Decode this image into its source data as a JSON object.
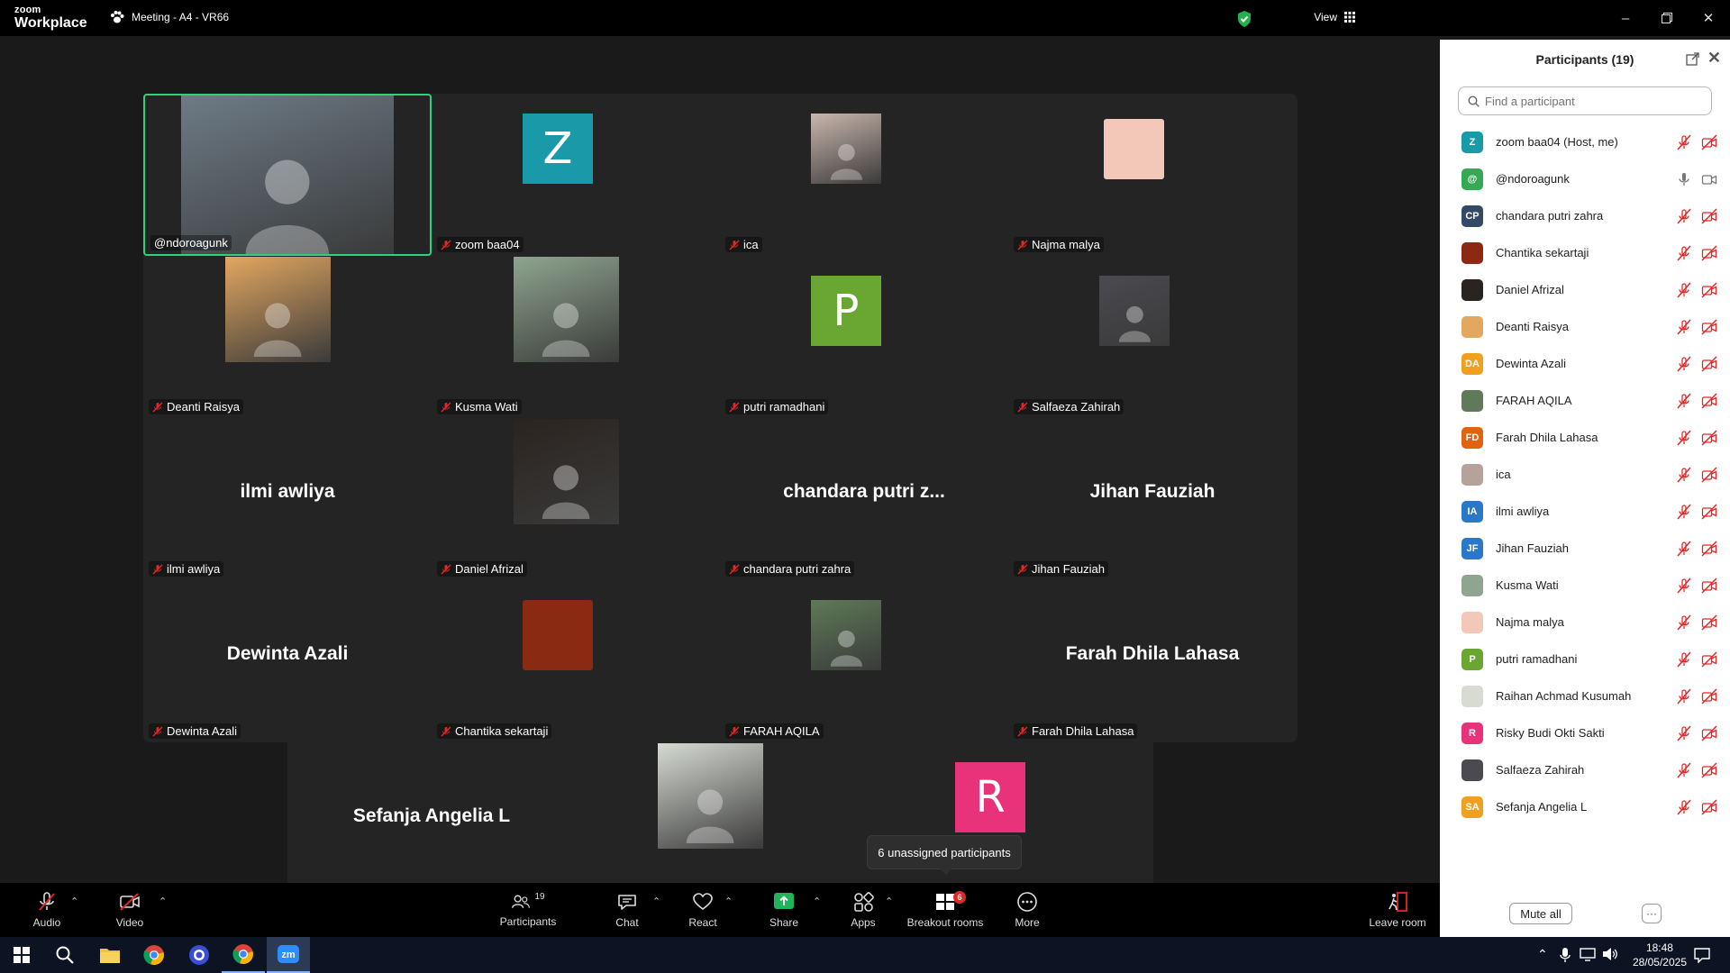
{
  "titlebar": {
    "brand_top": "zoom",
    "brand_bottom": "Workplace",
    "meeting_title": "Meeting - A4 - VR66",
    "view_label": "View"
  },
  "tiles": [
    {
      "label": "@ndoroagunk",
      "big": "",
      "kind": "photo",
      "color": "#6d7b86",
      "muted": false
    },
    {
      "label": "zoom baa04",
      "big": "",
      "kind": "letter",
      "letter": "Z",
      "color": "#1a9aa8",
      "muted": true
    },
    {
      "label": "ica",
      "big": "",
      "kind": "photo",
      "color": "#c9b7ad",
      "muted": true
    },
    {
      "label": "Najma malya",
      "big": "",
      "kind": "solid",
      "color": "#f3c8b9",
      "muted": true
    },
    {
      "label": "Deanti Raisya",
      "big": "",
      "kind": "photo",
      "color": "#e3a760",
      "muted": true
    },
    {
      "label": "Kusma Wati",
      "big": "",
      "kind": "photo",
      "color": "#8fa58f",
      "muted": true
    },
    {
      "label": "putri ramadhani",
      "big": "",
      "kind": "letter",
      "letter": "P",
      "color": "#6aa632",
      "muted": true
    },
    {
      "label": "Salfaeza Zahirah",
      "big": "",
      "kind": "photo",
      "color": "#4a4a50",
      "muted": true
    },
    {
      "label": "ilmi awliya",
      "big": "ilmi awliya",
      "kind": "text",
      "muted": true
    },
    {
      "label": "Daniel Afrizal",
      "big": "",
      "kind": "photo",
      "color": "#2a2420",
      "muted": true
    },
    {
      "label": "chandara putri zahra",
      "big": "chandara putri z...",
      "kind": "text",
      "muted": true
    },
    {
      "label": "Jihan Fauziah",
      "big": "Jihan Fauziah",
      "kind": "text",
      "muted": true
    },
    {
      "label": "Dewinta Azali",
      "big": "Dewinta Azali",
      "kind": "text",
      "muted": true
    },
    {
      "label": "Chantika sekartaji",
      "big": "",
      "kind": "solid",
      "color": "#8b2a12",
      "muted": true
    },
    {
      "label": "FARAH AQILA",
      "big": "",
      "kind": "photo",
      "color": "#5f7a58",
      "muted": true
    },
    {
      "label": "Farah Dhila Lahasa",
      "big": "Farah Dhila Lahasa",
      "kind": "text",
      "muted": true
    },
    {
      "label": "Sefanja Angelia L",
      "big": "Sefanja Angelia L",
      "kind": "text",
      "muted": true
    },
    {
      "label": "Raihan Achmad Kusumah",
      "big": "",
      "kind": "photo",
      "color": "#d7dbd4",
      "muted": true
    },
    {
      "label": "",
      "big": "",
      "kind": "letter",
      "letter": "R",
      "color": "#e8327a",
      "muted": false
    }
  ],
  "tooltip": "6 unassigned participants",
  "toolbar": {
    "audio": "Audio",
    "video": "Video",
    "participants": "Participants",
    "participants_count": "19",
    "chat": "Chat",
    "react": "React",
    "share": "Share",
    "apps": "Apps",
    "breakout": "Breakout rooms",
    "breakout_badge": "6",
    "more": "More",
    "leave": "Leave room"
  },
  "panel": {
    "title": "Participants (19)",
    "search_placeholder": "Find a participant",
    "mute_all": "Mute all",
    "more": "···",
    "participants": [
      {
        "name": "zoom baa04 (Host, me)",
        "initials": "Z",
        "color": "#1a9aa8",
        "mic": "muted"
      },
      {
        "name": "@ndoroagunk",
        "initials": "@",
        "color": "#34a853",
        "mic": "on"
      },
      {
        "name": "chandara putri zahra",
        "initials": "CP",
        "color": "#334a66",
        "mic": "muted"
      },
      {
        "name": "Chantika sekartaji",
        "initials": "",
        "color": "#8b2a12",
        "mic": "muted"
      },
      {
        "name": "Daniel Afrizal",
        "initials": "",
        "color": "#2a2420",
        "mic": "muted"
      },
      {
        "name": "Deanti Raisya",
        "initials": "",
        "color": "#e3a760",
        "mic": "muted"
      },
      {
        "name": "Dewinta Azali",
        "initials": "DA",
        "color": "#f0a01e",
        "mic": "muted"
      },
      {
        "name": "FARAH AQILA",
        "initials": "",
        "color": "#5f7a58",
        "mic": "muted"
      },
      {
        "name": "Farah Dhila Lahasa",
        "initials": "FD",
        "color": "#e0640f",
        "mic": "muted"
      },
      {
        "name": "ica",
        "initials": "",
        "color": "#b5a39a",
        "mic": "muted"
      },
      {
        "name": "ilmi awliya",
        "initials": "IA",
        "color": "#2b78c8",
        "mic": "muted"
      },
      {
        "name": "Jihan Fauziah",
        "initials": "JF",
        "color": "#2b78c8",
        "mic": "muted"
      },
      {
        "name": "Kusma Wati",
        "initials": "",
        "color": "#8fa58f",
        "mic": "muted"
      },
      {
        "name": "Najma malya",
        "initials": "",
        "color": "#f3c8b9",
        "mic": "muted"
      },
      {
        "name": "putri ramadhani",
        "initials": "P",
        "color": "#6aa632",
        "mic": "muted"
      },
      {
        "name": "Raihan Achmad Kusumah",
        "initials": "",
        "color": "#d7dbd4",
        "mic": "muted"
      },
      {
        "name": "Risky Budi Okti Sakti",
        "initials": "R",
        "color": "#e8327a",
        "mic": "muted"
      },
      {
        "name": "Salfaeza Zahirah",
        "initials": "",
        "color": "#4a4a50",
        "mic": "muted"
      },
      {
        "name": "Sefanja Angelia L",
        "initials": "SA",
        "color": "#f0a01e",
        "mic": "muted"
      }
    ]
  },
  "taskbar": {
    "time": "18:48",
    "date": "28/05/2025"
  },
  "colors": {
    "muted_red": "#e02828",
    "active_border": "#2fd17c",
    "share_green": "#1fb35a"
  }
}
